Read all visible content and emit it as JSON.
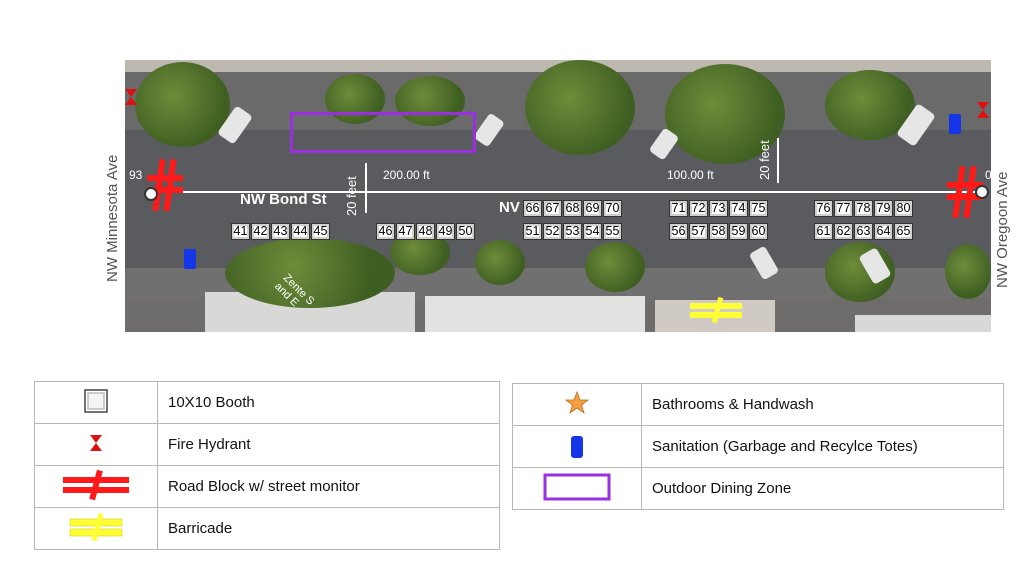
{
  "map": {
    "street_name": "NW Bond St",
    "street_prefix": "NV",
    "cross_street_west": "NW Minnesota Ave",
    "cross_street_east": "NW Oregoon Ave",
    "scale_200": "200.00 ft",
    "scale_100": "100.00 ft",
    "scale_93": "93",
    "scale_0": "0",
    "width_label_1": "20 feet",
    "width_label_2": "20 feet",
    "shop_text": "Zente S\nand E",
    "booths_top_row": [
      66,
      67,
      68,
      69,
      70,
      71,
      72,
      73,
      74,
      75,
      76,
      77,
      78,
      79,
      80
    ],
    "booths_bottom_row": [
      41,
      42,
      43,
      44,
      45,
      46,
      47,
      48,
      49,
      50,
      51,
      52,
      53,
      54,
      55,
      56,
      57,
      58,
      59,
      60,
      61,
      62,
      63,
      64,
      65
    ]
  },
  "legend_left": [
    {
      "icon": "booth-icon",
      "label": "10X10 Booth"
    },
    {
      "icon": "fire-hydrant-icon",
      "label": "Fire Hydrant"
    },
    {
      "icon": "road-block-icon",
      "label": "Road Block w/ street monitor"
    },
    {
      "icon": "barricade-icon",
      "label": "Barricade"
    }
  ],
  "legend_right": [
    {
      "icon": "star-icon",
      "label": "Bathrooms & Handwash"
    },
    {
      "icon": "trash-can-icon",
      "label": "Sanitation (Garbage and Recylce Totes)"
    },
    {
      "icon": "dining-zone-icon",
      "label": "Outdoor Dining Zone"
    }
  ],
  "colors": {
    "road_block": "#ff1a1a",
    "barricade": "#ffff33",
    "hydrant": "#e01010",
    "sanitation": "#1536e8",
    "dining_zone": "#9a2fe0",
    "star": "#f5a142"
  }
}
